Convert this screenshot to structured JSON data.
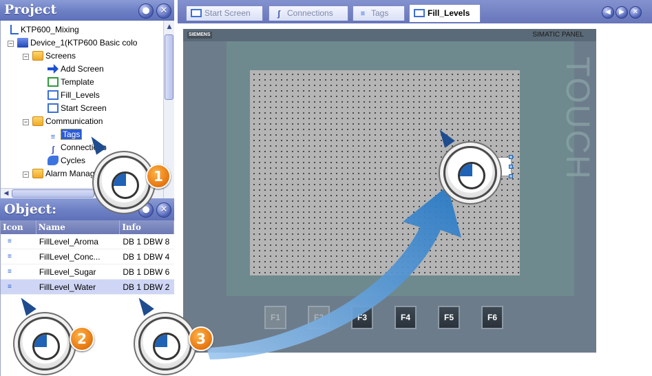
{
  "project_panel": {
    "title": "Project",
    "tree": [
      {
        "label": "KTP600_Mixing",
        "icon": "project-icon"
      },
      {
        "label": "Device_1(KTP600 Basic colo",
        "icon": "device-icon"
      },
      {
        "label": "Screens",
        "icon": "folder-icon"
      },
      {
        "label": "Add Screen",
        "icon": "add-screen-icon"
      },
      {
        "label": "Template",
        "icon": "screen-icon"
      },
      {
        "label": "Fill_Levels",
        "icon": "screen-icon"
      },
      {
        "label": "Start Screen",
        "icon": "screen-icon"
      },
      {
        "label": "Communication",
        "icon": "folder-icon"
      },
      {
        "label": "Tags",
        "icon": "tags-icon"
      },
      {
        "label": "Connections",
        "icon": "connections-icon"
      },
      {
        "label": "Cycles",
        "icon": "cycles-icon"
      },
      {
        "label": "Alarm Management",
        "icon": "folder-icon"
      }
    ]
  },
  "object_panel": {
    "title": "Object:",
    "columns": [
      "Icon",
      "Name",
      "Info"
    ],
    "rows": [
      {
        "name": "FillLevel_Aroma",
        "info": "DB 1 DBW 8"
      },
      {
        "name": "FillLevel_Conc...",
        "info": "DB 1 DBW 4"
      },
      {
        "name": "FillLevel_Sugar",
        "info": "DB 1 DBW 6"
      },
      {
        "name": "FillLevel_Water",
        "info": "DB 1 DBW 2"
      }
    ]
  },
  "tabs": [
    {
      "label": "Start Screen",
      "icon": "screen-icon"
    },
    {
      "label": "Connections",
      "icon": "connections-icon"
    },
    {
      "label": "Tags",
      "icon": "tags-icon"
    },
    {
      "label": "Fill_Levels",
      "icon": "screen-icon",
      "active": true
    }
  ],
  "device": {
    "brand": "SIEMENS",
    "model": "SIMATIC PANEL",
    "touch_label": "TOUCH",
    "io_field_value": "000.000",
    "function_keys": [
      "F1",
      "F2",
      "F3",
      "F4",
      "F5",
      "F6"
    ]
  },
  "steps": [
    "1",
    "2",
    "3"
  ],
  "colors": {
    "header_blue": "#6d7fc4",
    "selection_blue": "#2a5bd7",
    "badge_orange": "#e5750f",
    "display_gray": "#b5b5b5",
    "bezel_teal": "#6e8a8e"
  }
}
